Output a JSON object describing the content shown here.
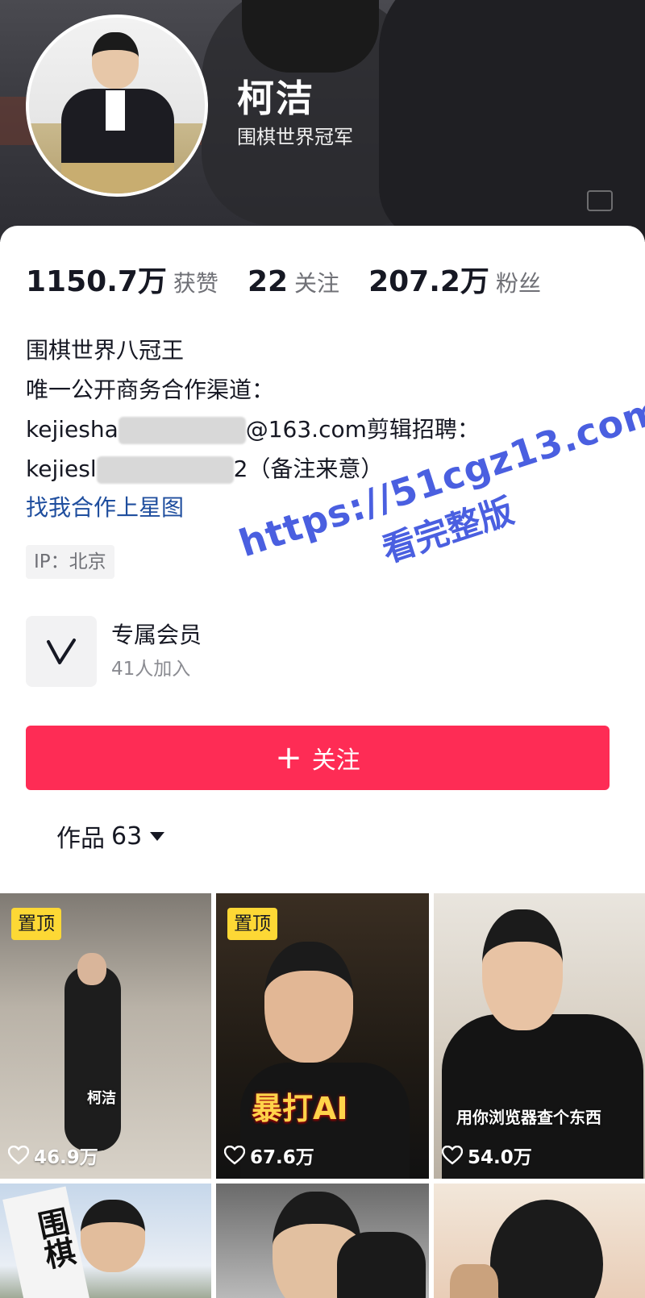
{
  "profile": {
    "name": "柯洁",
    "subtitle": "围棋世界冠军"
  },
  "stats": [
    {
      "value": "1150.7万",
      "label": "获赞"
    },
    {
      "value": "22",
      "label": "关注"
    },
    {
      "value": "207.2万",
      "label": "粉丝"
    }
  ],
  "bio": {
    "line1": "围棋世界八冠王",
    "line2": "唯一公开商务合作渠道：",
    "line3_prefix": "kejiesha",
    "line3_suffix": "@163.com剪辑招聘：",
    "line4_prefix": "kejiesl",
    "line4_suffix": "2（备注来意）",
    "link": "找我合作上星图"
  },
  "ip_tag": "IP：北京",
  "membership": {
    "title": "专属会员",
    "subtitle": "41人加入"
  },
  "follow_button": {
    "icon": "+",
    "label": "关注"
  },
  "works_tab": {
    "label": "作品",
    "count": "63"
  },
  "videos": [
    {
      "pinned": "置顶",
      "caption": "柯洁",
      "likes": "46.9万"
    },
    {
      "pinned": "置顶",
      "caption": "暴打AI",
      "likes": "67.6万"
    },
    {
      "pinned": "",
      "caption": "用你浏览器查个东西",
      "likes": "54.0万"
    },
    {
      "caption": "围棋",
      "likes": ""
    },
    {
      "caption": "",
      "likes": ""
    },
    {
      "caption": "",
      "likes": ""
    }
  ],
  "watermark": {
    "line1": "https://51cgz13.com",
    "line2": "看完整版"
  },
  "colors": {
    "accent": "#fe2c55",
    "link": "#1f4e9e",
    "pin_badge": "#fdd835",
    "watermark": "#4a5fe0"
  }
}
